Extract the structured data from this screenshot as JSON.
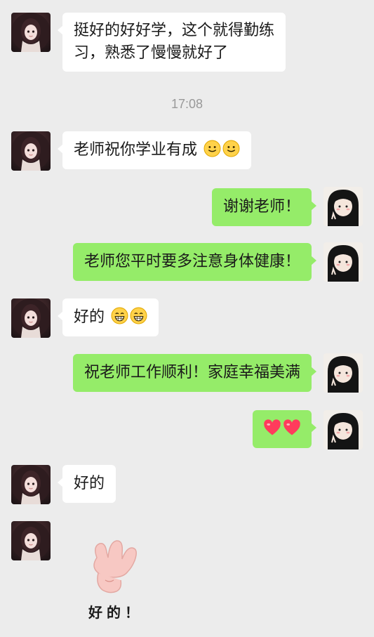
{
  "conversation": {
    "messages": [
      {
        "from": "teacher",
        "text_line1": "挺好的好好学，这个就得勤练",
        "text_line2": "习，熟悉了慢慢就好了"
      },
      {
        "from": "teacher",
        "text": "老师祝你学业有成",
        "emojis": [
          "smile-emoji",
          "smile-emoji"
        ]
      },
      {
        "from": "student",
        "text": "谢谢老师！"
      },
      {
        "from": "student",
        "text": "老师您平时要多注意身体健康！"
      },
      {
        "from": "teacher",
        "text": "好的",
        "emojis": [
          "grin-emoji",
          "grin-emoji"
        ]
      },
      {
        "from": "student",
        "text": "祝老师工作顺利！家庭幸福美满"
      },
      {
        "from": "student",
        "emojis": [
          "heart-emoji",
          "heart-emoji"
        ]
      },
      {
        "from": "teacher",
        "text": "好的"
      },
      {
        "from": "teacher",
        "sticker": "ok-hand-sticker",
        "sticker_text": "好的！"
      }
    ],
    "timestamp": "17:08"
  },
  "colors": {
    "background": "#ececec",
    "outgoing_bubble": "#95ec69",
    "incoming_bubble": "#ffffff",
    "timestamp": "#999999"
  }
}
